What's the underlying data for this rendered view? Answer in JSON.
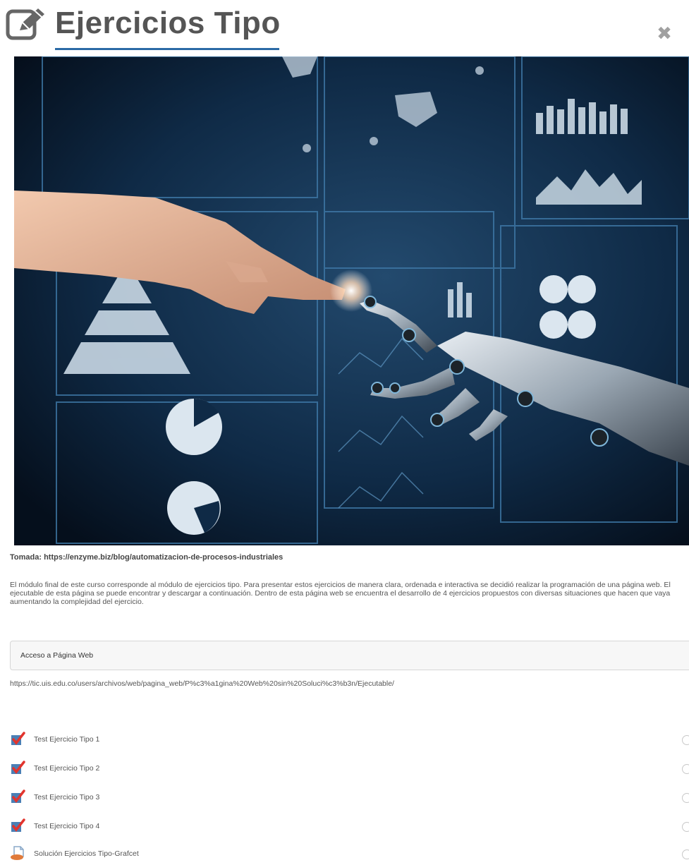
{
  "header": {
    "title": "Ejercicios Tipo",
    "close_label": "✖",
    "accent_color": "#2b6aa6"
  },
  "hero": {
    "image_description_icon": "hero-image",
    "caption": "Tomada: https://enzyme.biz/blog/automatizacion-de-procesos-industriales"
  },
  "body": {
    "paragraph": "El módulo final de este curso corresponde al módulo de ejercicios tipo. Para presentar estos ejercicios de manera clara, ordenada e interactiva se decidió realizar la programación de una página web. El ejecutable de esta página se puede encontrar y descargar a continuación. Dentro de esta página web se encuentra el desarrollo de 4 ejercicios propuestos con diversas situaciones que hacen que vaya aumentando la complejidad del ejercicio."
  },
  "access": {
    "label": "Acceso a Página Web",
    "url": "https://tic.uis.edu.co/users/archivos/web/pagina_web/P%c3%a1gina%20Web%20sin%20Soluci%c3%b3n/Ejecutable/"
  },
  "activities": [
    {
      "label": "Test Ejercicio Tipo 1",
      "icon": "quiz-check-icon"
    },
    {
      "label": "Test Ejercicio Tipo 2",
      "icon": "quiz-check-icon"
    },
    {
      "label": "Test Ejercicio Tipo 3",
      "icon": "quiz-check-icon"
    },
    {
      "label": "Test Ejercicio Tipo 4",
      "icon": "quiz-check-icon"
    },
    {
      "label": "Solución Ejercicios Tipo-Grafcet",
      "icon": "file-icon"
    }
  ]
}
